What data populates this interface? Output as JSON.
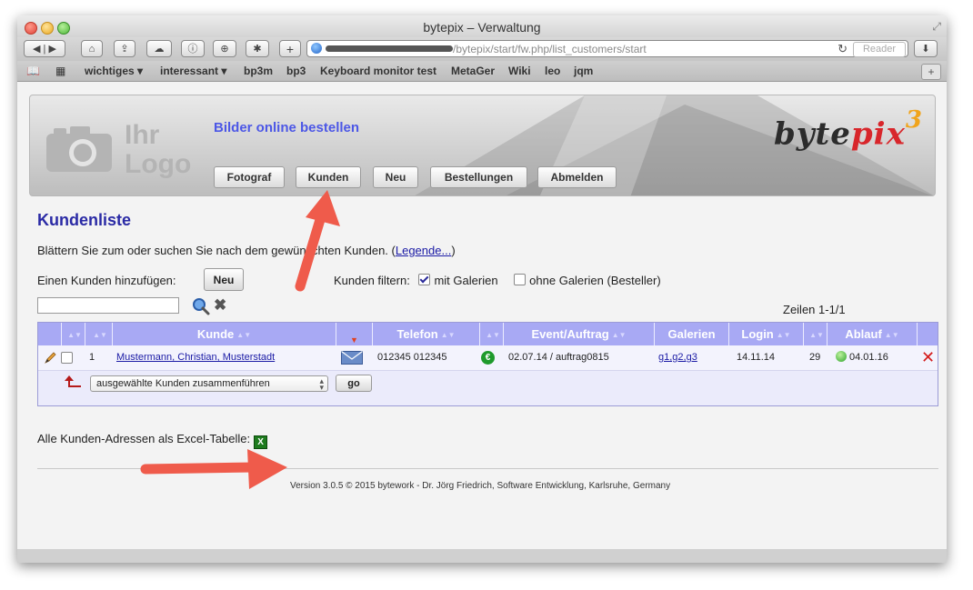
{
  "window": {
    "title": "bytepix – Verwaltung"
  },
  "toolbar": {
    "url_path": "/bytepix/start/fw.php/list_customers/start",
    "reader_label": "Reader",
    "reload_glyph": "↻",
    "icons": [
      "back-icon",
      "forward-icon",
      "home-icon",
      "share-icon",
      "icloud-icon",
      "info-icon",
      "download-icon",
      "extension-icon",
      "new-tab-icon",
      "globe-icon",
      "reload-icon",
      "reader-icon",
      "downloads-icon"
    ]
  },
  "bookmarks": {
    "items": [
      "wichtiges ▾",
      "interessant ▾",
      "bp3m",
      "bp3",
      "Keyboard monitor test",
      "MetaGer",
      "Wiki",
      "leo",
      "jqm"
    ],
    "plus": "+"
  },
  "banner": {
    "logo_line1": "Ihr",
    "logo_line2": "Logo",
    "tagline": "Bilder online bestellen",
    "brand_part1": "byte",
    "brand_part2": "pix",
    "brand_sup": "3"
  },
  "nav": {
    "items": [
      "Fotograf",
      "Kunden",
      "Neu",
      "Bestellungen",
      "Abmelden"
    ]
  },
  "page": {
    "title": "Kundenliste",
    "intro_text": "Blättern Sie zum oder suchen Sie nach dem gewünschten Kunden. (",
    "intro_link": "Legende...",
    "intro_close": ")",
    "add_label": "Einen Kunden hinzufügen:",
    "add_button": "Neu",
    "filter_label": "Kunden filtern:",
    "filter_with": "mit Galerien",
    "filter_without": "ohne Galerien (Besteller)",
    "search_value": "",
    "rows_info": "Zeilen 1-1/1"
  },
  "table": {
    "headers": {
      "kunde": "Kunde",
      "telefon": "Telefon",
      "event": "Event/Auftrag",
      "galerien": "Galerien",
      "login": "Login",
      "ablauf": "Ablauf"
    },
    "row": {
      "num": "1",
      "kunde": "Mustermann, Christian, Musterstadt",
      "telefon": "012345 012345",
      "euro": "€",
      "event": "02.07.14 / auftrag0815",
      "galerien": "g1,g2,g3",
      "login": "14.11.14",
      "count": "29",
      "ablauf": "04.01.16",
      "delete": "✕"
    },
    "merge_select": "ausgewählte Kunden zusammenführen",
    "go_button": "go"
  },
  "excel": {
    "label": "Alle Kunden-Adressen als Excel-Tabelle:",
    "icon": "X"
  },
  "footer": {
    "text": "Version 3.0.5 © 2015 bytework - Dr. Jörg Friedrich, Software Entwicklung, Karlsruhe, Germany"
  },
  "colors": {
    "accent": "#4c57e6",
    "header_bg": "#a8a9f4",
    "title": "#2a2aa5",
    "arrow": "#ef5b4b"
  }
}
